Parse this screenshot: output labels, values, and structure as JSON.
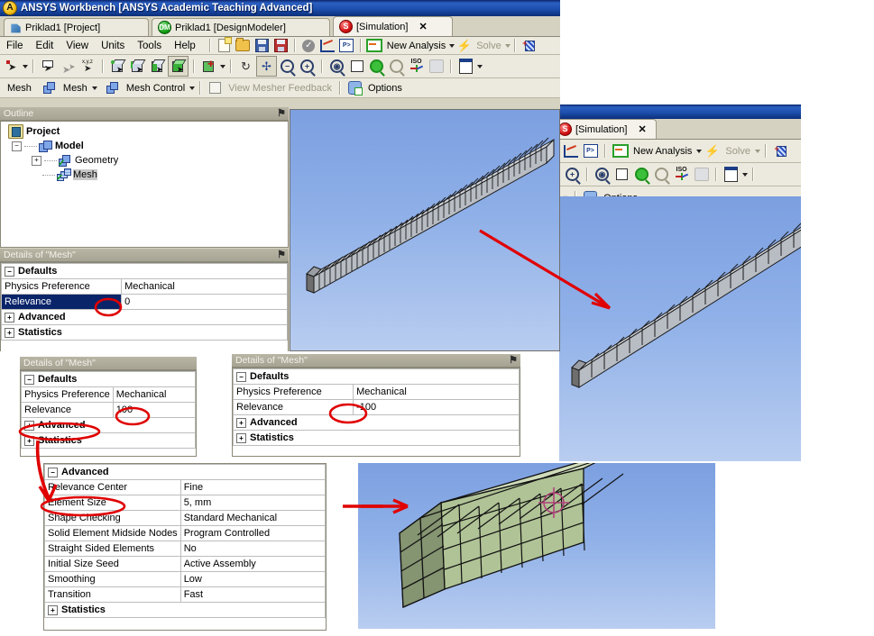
{
  "app": {
    "title": "ANSYS Workbench [ANSYS Academic Teaching Advanced]",
    "logo_glyph": "A"
  },
  "tabs": [
    {
      "label": "Priklad1 [Project]",
      "icon": "project-icon",
      "active": false,
      "closable": false
    },
    {
      "label": "Priklad1 [DesignModeler]",
      "icon": "designmodeler-icon",
      "icon_text": "DM",
      "active": false,
      "closable": false
    },
    {
      "label": "[Simulation]",
      "icon": "simulation-icon",
      "icon_text": "S",
      "active": true,
      "closable": true,
      "close_glyph": "✕"
    }
  ],
  "menu": [
    "File",
    "Edit",
    "View",
    "Units",
    "Tools",
    "Help"
  ],
  "toolbar_main": {
    "items": [
      {
        "name": "select-cursor",
        "type": "icon-dropdown"
      },
      {
        "name": "box-select-icon",
        "type": "icon"
      },
      {
        "name": "extend-selection-icon",
        "type": "icon"
      },
      {
        "name": "xyz-select-icon",
        "type": "icon"
      },
      {
        "name": "vertex-select-icon",
        "type": "icon"
      },
      {
        "name": "edge-select-icon",
        "type": "icon"
      },
      {
        "name": "face-select-icon",
        "type": "icon"
      },
      {
        "name": "body-select-icon",
        "type": "icon"
      },
      {
        "name": "coordinate-system-icon",
        "type": "icon-dropdown"
      },
      {
        "name": "refresh-icon",
        "type": "icon"
      }
    ],
    "file_new": "new-document-icon",
    "file_open": "open-folder-icon",
    "file_save": "save-icon",
    "file_saveas": "save-as-icon",
    "solve_check": "check-icon",
    "chart": "chart-icon",
    "parameters": "parameters-icon",
    "new_analysis": "New Analysis",
    "solve": "Solve"
  },
  "toolbar_view": {
    "pan": "pan-icon",
    "zoom_out": "zoom-out-icon",
    "zoom_in": "zoom-in-icon",
    "zoom_fit": "zoom-to-fit-icon",
    "box_zoom": "box-zoom-icon",
    "magnify_plus": "magnify-icon",
    "magnify_minus": "magnify-dim-icon",
    "iso": "ISO",
    "look_at": "look-at-face-icon",
    "color_swatch": "color-swatch"
  },
  "toolbar_mesh": {
    "label": "Mesh",
    "mesh_button": "Mesh",
    "mesh_control": "Mesh Control",
    "view_mesher_feedback": "View Mesher Feedback",
    "options": "Options"
  },
  "outline": {
    "title": "Outline",
    "pin_glyph": "⚑",
    "nodes": [
      {
        "label": "Project",
        "icon": "project-folder-icon",
        "depth": 0,
        "toggle": "",
        "bold": true,
        "check": false,
        "selected": false
      },
      {
        "label": "Model",
        "icon": "model-icon",
        "depth": 1,
        "toggle": "−",
        "bold": true,
        "check": false,
        "selected": false
      },
      {
        "label": "Geometry",
        "icon": "geometry-icon",
        "depth": 2,
        "toggle": "+",
        "bold": false,
        "check": true,
        "selected": false
      },
      {
        "label": "Mesh",
        "icon": "mesh-icon",
        "depth": 2,
        "toggle": "",
        "bold": false,
        "check": true,
        "selected": true
      }
    ]
  },
  "details_main": {
    "title": "Details of \"Mesh\"",
    "pin_glyph": "⚑",
    "rows": [
      {
        "type": "group",
        "toggle": "−",
        "label": "Defaults"
      },
      {
        "type": "prop",
        "label": "Physics Preference",
        "value": "Mechanical"
      },
      {
        "type": "prop",
        "label": "Relevance",
        "value": "0",
        "label_selected": true,
        "circled": true
      },
      {
        "type": "group",
        "toggle": "+",
        "label": "Advanced"
      },
      {
        "type": "group",
        "toggle": "+",
        "label": "Statistics"
      }
    ]
  },
  "details_mid_left": {
    "title": "Details of \"Mesh\"",
    "rows": [
      {
        "type": "group",
        "toggle": "−",
        "label": "Defaults"
      },
      {
        "type": "prop",
        "label": "Physics Preference",
        "value": "Mechanical"
      },
      {
        "type": "prop",
        "label": "Relevance",
        "value": "100",
        "circled": true
      },
      {
        "type": "group",
        "toggle": "+",
        "label": "Advanced",
        "circled": true
      },
      {
        "type": "group",
        "toggle": "+",
        "label": "Statistics"
      }
    ]
  },
  "details_mid_right": {
    "title": "Details of \"Mesh\"",
    "pin_glyph": "⚑",
    "rows": [
      {
        "type": "group",
        "toggle": "−",
        "label": "Defaults"
      },
      {
        "type": "prop",
        "label": "Physics Preference",
        "value": "Mechanical"
      },
      {
        "type": "prop",
        "label": "Relevance",
        "value": "-100",
        "circled": true
      },
      {
        "type": "group",
        "toggle": "+",
        "label": "Advanced"
      },
      {
        "type": "group",
        "toggle": "+",
        "label": "Statistics"
      }
    ]
  },
  "details_advanced": {
    "rows": [
      {
        "type": "group",
        "toggle": "−",
        "label": "Advanced"
      },
      {
        "type": "prop",
        "label": "Relevance Center",
        "value": "Fine"
      },
      {
        "type": "prop",
        "label": "Element Size",
        "value": "5, mm",
        "circled": true
      },
      {
        "type": "prop",
        "label": "Shape Checking",
        "value": "Standard Mechanical"
      },
      {
        "type": "prop",
        "label": "Solid Element Midside Nodes",
        "value": "Program Controlled"
      },
      {
        "type": "prop",
        "label": "Straight Sided Elements",
        "value": "No"
      },
      {
        "type": "prop",
        "label": "Initial Size Seed",
        "value": "Active Assembly"
      },
      {
        "type": "prop",
        "label": "Smoothing",
        "value": "Low"
      },
      {
        "type": "prop",
        "label": "Transition",
        "value": "Fast"
      },
      {
        "type": "group",
        "toggle": "+",
        "label": "Statistics"
      }
    ]
  },
  "viewports": [
    {
      "name": "viewport-fine-mesh",
      "elements": 46,
      "mesh_color": "#c5c9cf",
      "description": "slender meshed beam, very fine mesh"
    },
    {
      "name": "viewport-coarse-mesh",
      "elements": 18,
      "mesh_color": "#c5c9cf",
      "description": "slender meshed beam, coarse mesh"
    },
    {
      "name": "viewport-element-size-mesh",
      "elements": 12,
      "mesh_color": "#b9ceaa",
      "description": "green meshed beam close-up, 2x4 cross section"
    }
  ],
  "annotations": {
    "highlight_color": "#e00000",
    "arrows": [
      {
        "name": "arrow-relevance-to-coarse-view"
      },
      {
        "name": "arrow-advanced-to-element-size"
      },
      {
        "name": "arrow-element-size-to-mesh-view"
      }
    ]
  },
  "colors": {
    "titlebar": "#0a246a",
    "panel_bg": "#d6d2c2",
    "toolbar_bg": "#eceade",
    "selection": "#0a246a",
    "annotation_red": "#e00000",
    "viewport_top": "#7c9fe0",
    "viewport_bottom": "#b9cdf0"
  }
}
